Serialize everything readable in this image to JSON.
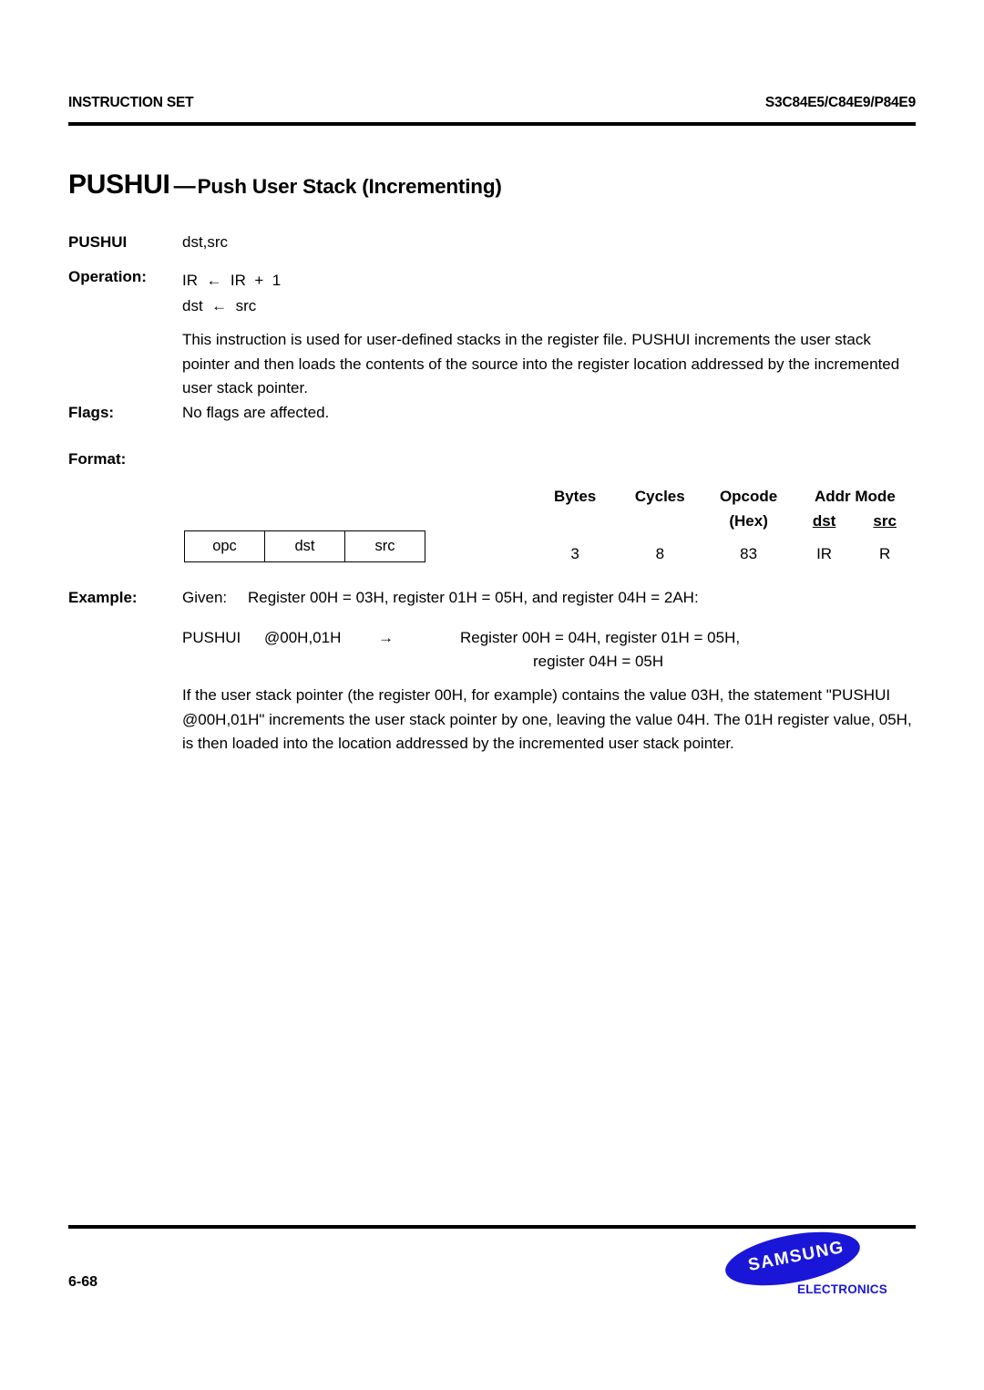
{
  "header": {
    "left": "INSTRUCTION SET",
    "right": "S3C84E5/C84E9/P84E9"
  },
  "title": {
    "mnemonic": "PUSHUI",
    "dash": "—",
    "description": "Push User Stack (Incrementing)"
  },
  "syntax": {
    "label": "PUSHUI",
    "operands": "dst,src"
  },
  "operation": {
    "label": "Operation:",
    "lines": [
      "IR  ←  IR  +  1",
      "dst  ←  src"
    ]
  },
  "description": {
    "text": "This instruction is used for user-defined stacks in the register file. PUSHUI increments the user stack pointer and then loads the contents of the source into the register location addressed by the incremented user stack pointer."
  },
  "flags": {
    "label": "Flags:",
    "value": "No flags are affected."
  },
  "format": {
    "label": "Format:",
    "opcode_box": [
      "opc",
      "dst",
      "src"
    ],
    "headers": {
      "bytes": "Bytes",
      "cycles": "Cycles",
      "opcode": "Opcode",
      "opcode_sub": "(Hex)",
      "addr_mode": "Addr Mode",
      "dst": "dst",
      "src": "src"
    },
    "values": {
      "bytes": "3",
      "cycles": "8",
      "opcode": "83",
      "dst": "IR",
      "src": "R"
    }
  },
  "example": {
    "label": "Example:",
    "given_word": "Given:",
    "given_text": "Register 00H  =  03H, register 01H  =  05H, and register 04H  =  2AH:",
    "statement": {
      "op": "PUSHUI",
      "args": "@00H,01H",
      "arrow": "→",
      "result_line1": "Register 00H  =  04H, register 01H  =  05H,",
      "result_line2": "register 04H  =  05H"
    }
  },
  "closing": {
    "text": "If the user stack pointer (the register 00H, for example) contains the value 03H, the statement \"PUSHUI @00H,01H\" increments the user stack pointer by one, leaving the value 04H. The 01H register value, 05H, is then loaded into the location addressed by the incremented user stack pointer."
  },
  "footer": {
    "page_number": "6-68",
    "logo_wordmark": "SAMSUNG",
    "logo_sub": "ELECTRONICS",
    "logo_color": "#1a16d8"
  }
}
